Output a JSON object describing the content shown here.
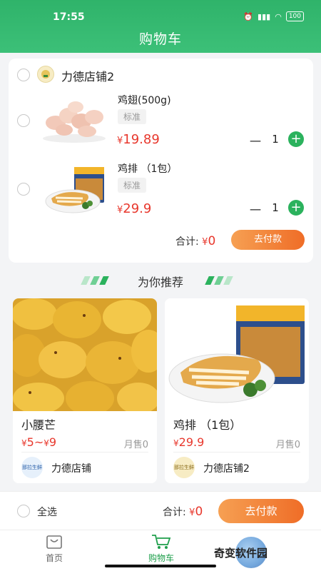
{
  "status_bar": {
    "time": "17:55",
    "battery": "100"
  },
  "header": {
    "title": "购物车"
  },
  "cart": {
    "store": {
      "name": "力德店铺2",
      "logo_icon": "store-badge-icon"
    },
    "items": [
      {
        "name": "鸡翅(500g)",
        "spec": "标准",
        "currency": "¥",
        "price": "19.89",
        "minus": "一",
        "quantity": "1",
        "plus": "+"
      },
      {
        "name": "鸡排 （1包）",
        "spec": "标准",
        "currency": "¥",
        "price": "29.9",
        "minus": "一",
        "quantity": "1",
        "plus": "+"
      }
    ],
    "subtotal_label": "合计:",
    "subtotal_currency": "¥",
    "subtotal_value": "0",
    "pay_label": "去付款"
  },
  "recommend": {
    "title": "为你推荐",
    "items": [
      {
        "name": "小腰芒",
        "price_currency": "¥",
        "price_low": "5",
        "price_sep": "~",
        "price_currency2": "¥",
        "price_high": "9",
        "sales": "月售0",
        "store_name": "力德店铺",
        "store_logo_text": "那拉生鲜"
      },
      {
        "name": "鸡排 （1包）",
        "price_currency": "¥",
        "price": "29.9",
        "sales": "月售0",
        "store_name": "力德店铺2",
        "store_logo_text": "那拉生鲜"
      }
    ]
  },
  "checkout_bar": {
    "select_all_label": "全选",
    "total_label": "合计:",
    "total_currency": "¥",
    "total_value": "0",
    "pay_label": "去付款"
  },
  "tabbar": {
    "tabs": [
      {
        "label": "首页",
        "icon": "home-icon",
        "active": false
      },
      {
        "label": "购物车",
        "icon": "cart-icon",
        "active": true
      }
    ]
  },
  "watermark": {
    "text": "奇变软件园"
  },
  "colors": {
    "brand_green": "#2fb36a",
    "price_red": "#e8372c",
    "pay_orange": "#ef6d27"
  }
}
